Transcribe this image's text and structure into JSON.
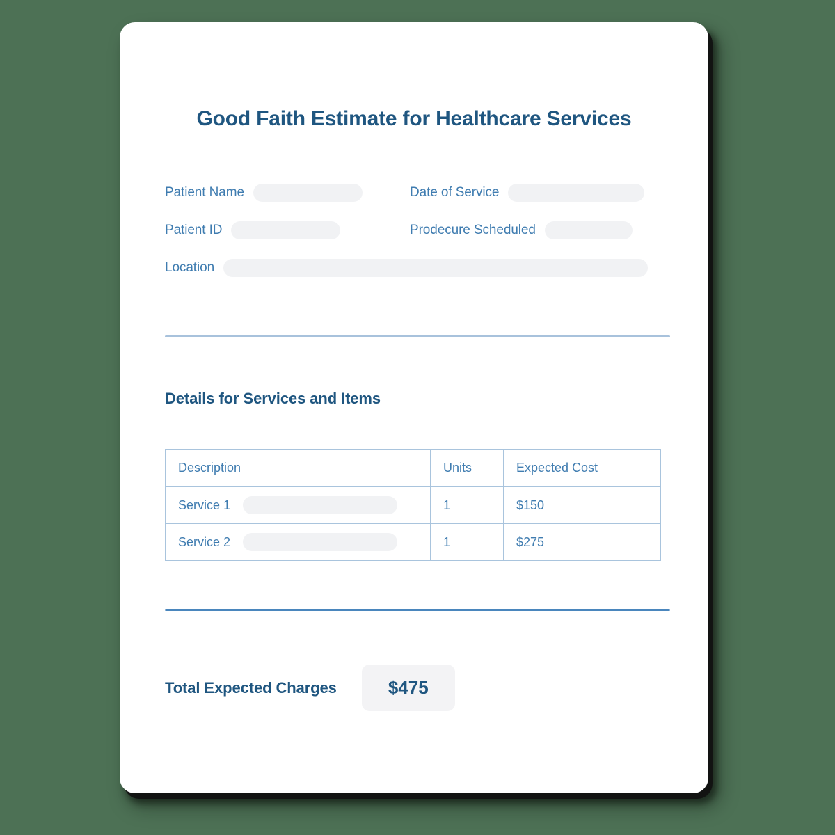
{
  "document": {
    "title": "Good Faith Estimate for Healthcare Services",
    "fields": [
      {
        "label": "Patient Name",
        "value": ""
      },
      {
        "label": "Date of Service",
        "value": ""
      },
      {
        "label": "Patient ID",
        "value": ""
      },
      {
        "label": "Prodecure Scheduled",
        "value": ""
      },
      {
        "label": "Location",
        "value": ""
      }
    ],
    "section_heading": "Details for Services and Items",
    "table": {
      "headers": [
        "Description",
        "Units",
        "Expected Cost"
      ],
      "rows": [
        {
          "description": "Service 1",
          "detail": "",
          "units": "1",
          "cost": "$150"
        },
        {
          "description": "Service 2",
          "detail": "",
          "units": "1",
          "cost": "$275"
        }
      ]
    },
    "total": {
      "label": "Total Expected Charges",
      "value": "$475"
    },
    "colors": {
      "page_background": "#4d7155",
      "card_background": "#ffffff",
      "heading_blue": "#1f5680",
      "label_blue": "#3f7cb0",
      "divider_light": "#a8c2dc",
      "divider_strong": "#4a86bd",
      "placeholder_gray": "#f1f2f4",
      "table_border": "#a9c4dd"
    }
  }
}
